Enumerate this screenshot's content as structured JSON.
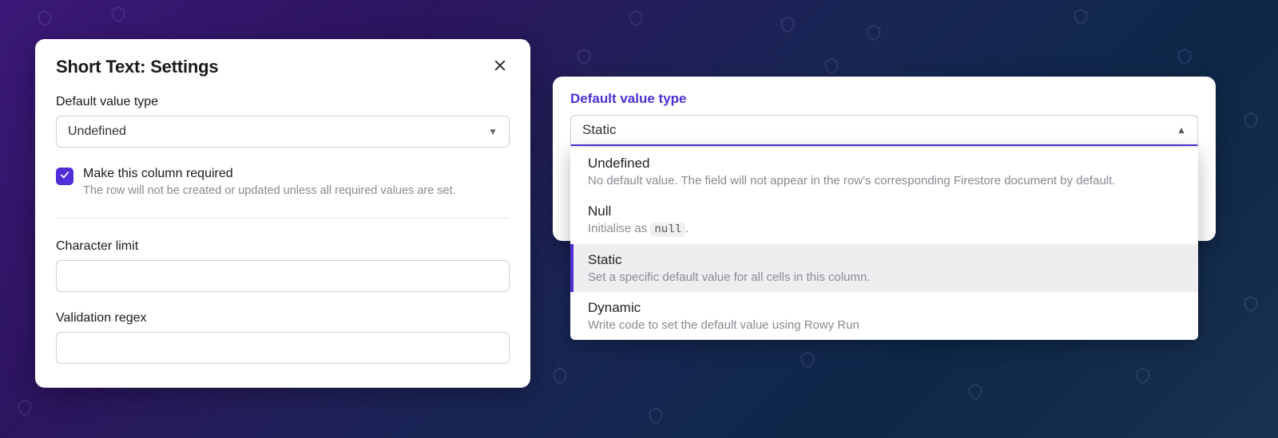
{
  "settings": {
    "title": "Short Text: Settings",
    "default_value_type_label": "Default value type",
    "default_value_type_selected": "Undefined",
    "required_checkbox": {
      "checked": true,
      "label": "Make this column required",
      "description": "The row will not be created or updated unless all required values are set."
    },
    "character_limit": {
      "label": "Character limit",
      "value": ""
    },
    "validation_regex": {
      "label": "Validation regex",
      "value": ""
    }
  },
  "dropdown": {
    "label": "Default value type",
    "selected": "Static",
    "options": [
      {
        "title": "Undefined",
        "desc_pre": "No default value. The field will not appear in the row's corresponding Firestore document by default.",
        "code": "",
        "desc_post": "",
        "selected": false
      },
      {
        "title": "Null",
        "desc_pre": "Initialise as ",
        "code": "null",
        "desc_post": ".",
        "selected": false
      },
      {
        "title": "Static",
        "desc_pre": "Set a specific default value for all cells in this column.",
        "code": "",
        "desc_post": "",
        "selected": true
      },
      {
        "title": "Dynamic",
        "desc_pre": "Write code to set the default value using Rowy Run",
        "code": "",
        "desc_post": "",
        "selected": false
      }
    ]
  }
}
